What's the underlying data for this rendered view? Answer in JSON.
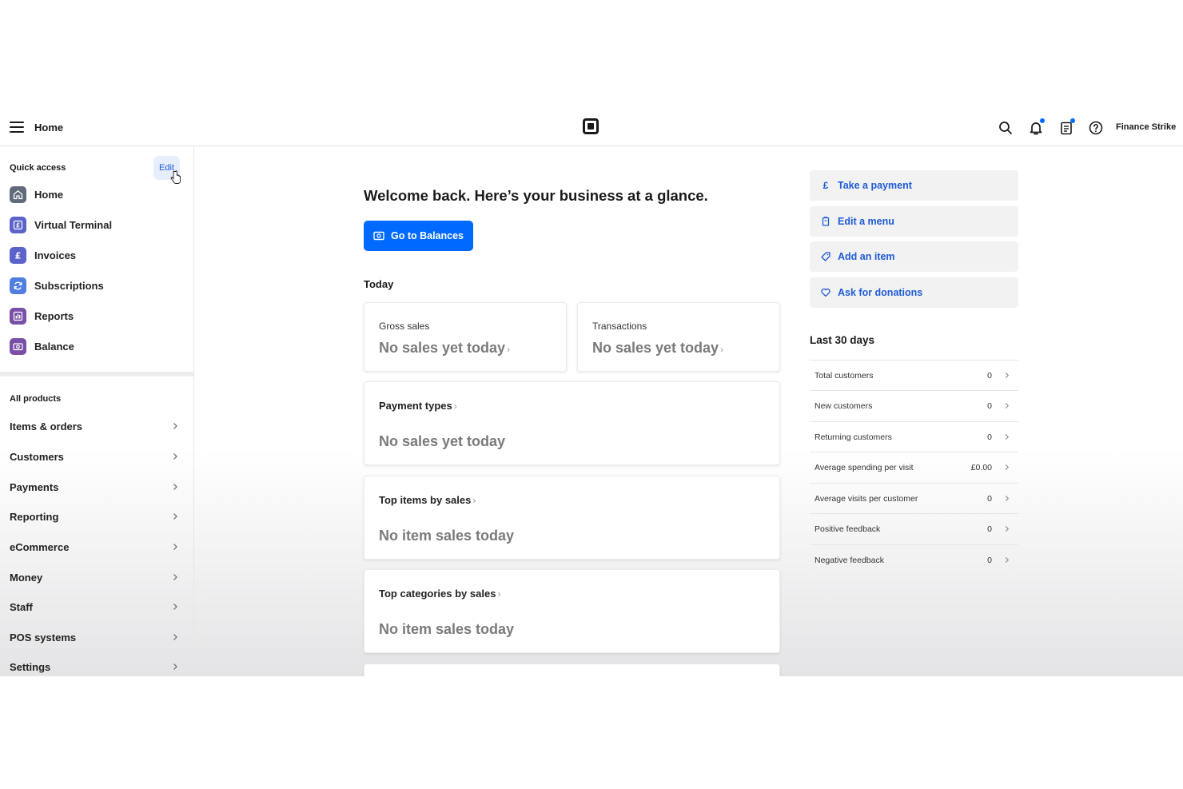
{
  "topbar": {
    "title": "Home",
    "account_name": "Finance Strike",
    "icons": [
      "menu-icon",
      "square-logo",
      "search-icon",
      "bell-icon",
      "clipboard-icon",
      "help-icon"
    ]
  },
  "sidebar": {
    "quick_access_heading": "Quick access",
    "edit_label": "Edit",
    "quick_access": [
      {
        "label": "Home",
        "icon": "home-icon",
        "color": "#5f6a7a"
      },
      {
        "label": "Virtual Terminal",
        "icon": "pound-card-icon",
        "color": "#5b63c9"
      },
      {
        "label": "Invoices",
        "icon": "pound-icon",
        "color": "#5b63c9"
      },
      {
        "label": "Subscriptions",
        "icon": "refresh-icon",
        "color": "#4f7de0"
      },
      {
        "label": "Reports",
        "icon": "chart-icon",
        "color": "#7a4fa8"
      },
      {
        "label": "Balance",
        "icon": "cash-icon",
        "color": "#7a4fa8"
      }
    ],
    "all_products_heading": "All products",
    "products": [
      "Items & orders",
      "Customers",
      "Payments",
      "Reporting",
      "eCommerce",
      "Money",
      "Staff",
      "POS systems",
      "Settings"
    ]
  },
  "main": {
    "welcome": "Welcome back. Here’s your business at a glance.",
    "balances_button": "Go to Balances",
    "today_heading": "Today",
    "gross_sales": {
      "label": "Gross sales",
      "value": "No sales yet today"
    },
    "transactions": {
      "label": "Transactions",
      "value": "No sales yet today"
    },
    "payment_types": {
      "label": "Payment types",
      "value": "No sales yet today"
    },
    "top_items": {
      "label": "Top items by sales",
      "value": "No item sales today"
    },
    "top_categories": {
      "label": "Top categories by sales",
      "value": "No item sales today"
    }
  },
  "actions": [
    {
      "label": "Take a payment",
      "icon": "pound-icon"
    },
    {
      "label": "Edit a menu",
      "icon": "menu-book-icon"
    },
    {
      "label": "Add an item",
      "icon": "tag-icon"
    },
    {
      "label": "Ask for donations",
      "icon": "heart-icon"
    }
  ],
  "last30": {
    "heading": "Last 30 days",
    "rows": [
      {
        "label": "Total customers",
        "value": "0"
      },
      {
        "label": "New customers",
        "value": "0"
      },
      {
        "label": "Returning customers",
        "value": "0"
      },
      {
        "label": "Average spending per visit",
        "value": "£0.00"
      },
      {
        "label": "Average visits per customer",
        "value": "0"
      },
      {
        "label": "Positive feedback",
        "value": "0"
      },
      {
        "label": "Negative feedback",
        "value": "0"
      }
    ]
  },
  "colors": {
    "accent": "#006aff",
    "link": "#1e5bd6",
    "notification_dot": "#006aff"
  }
}
